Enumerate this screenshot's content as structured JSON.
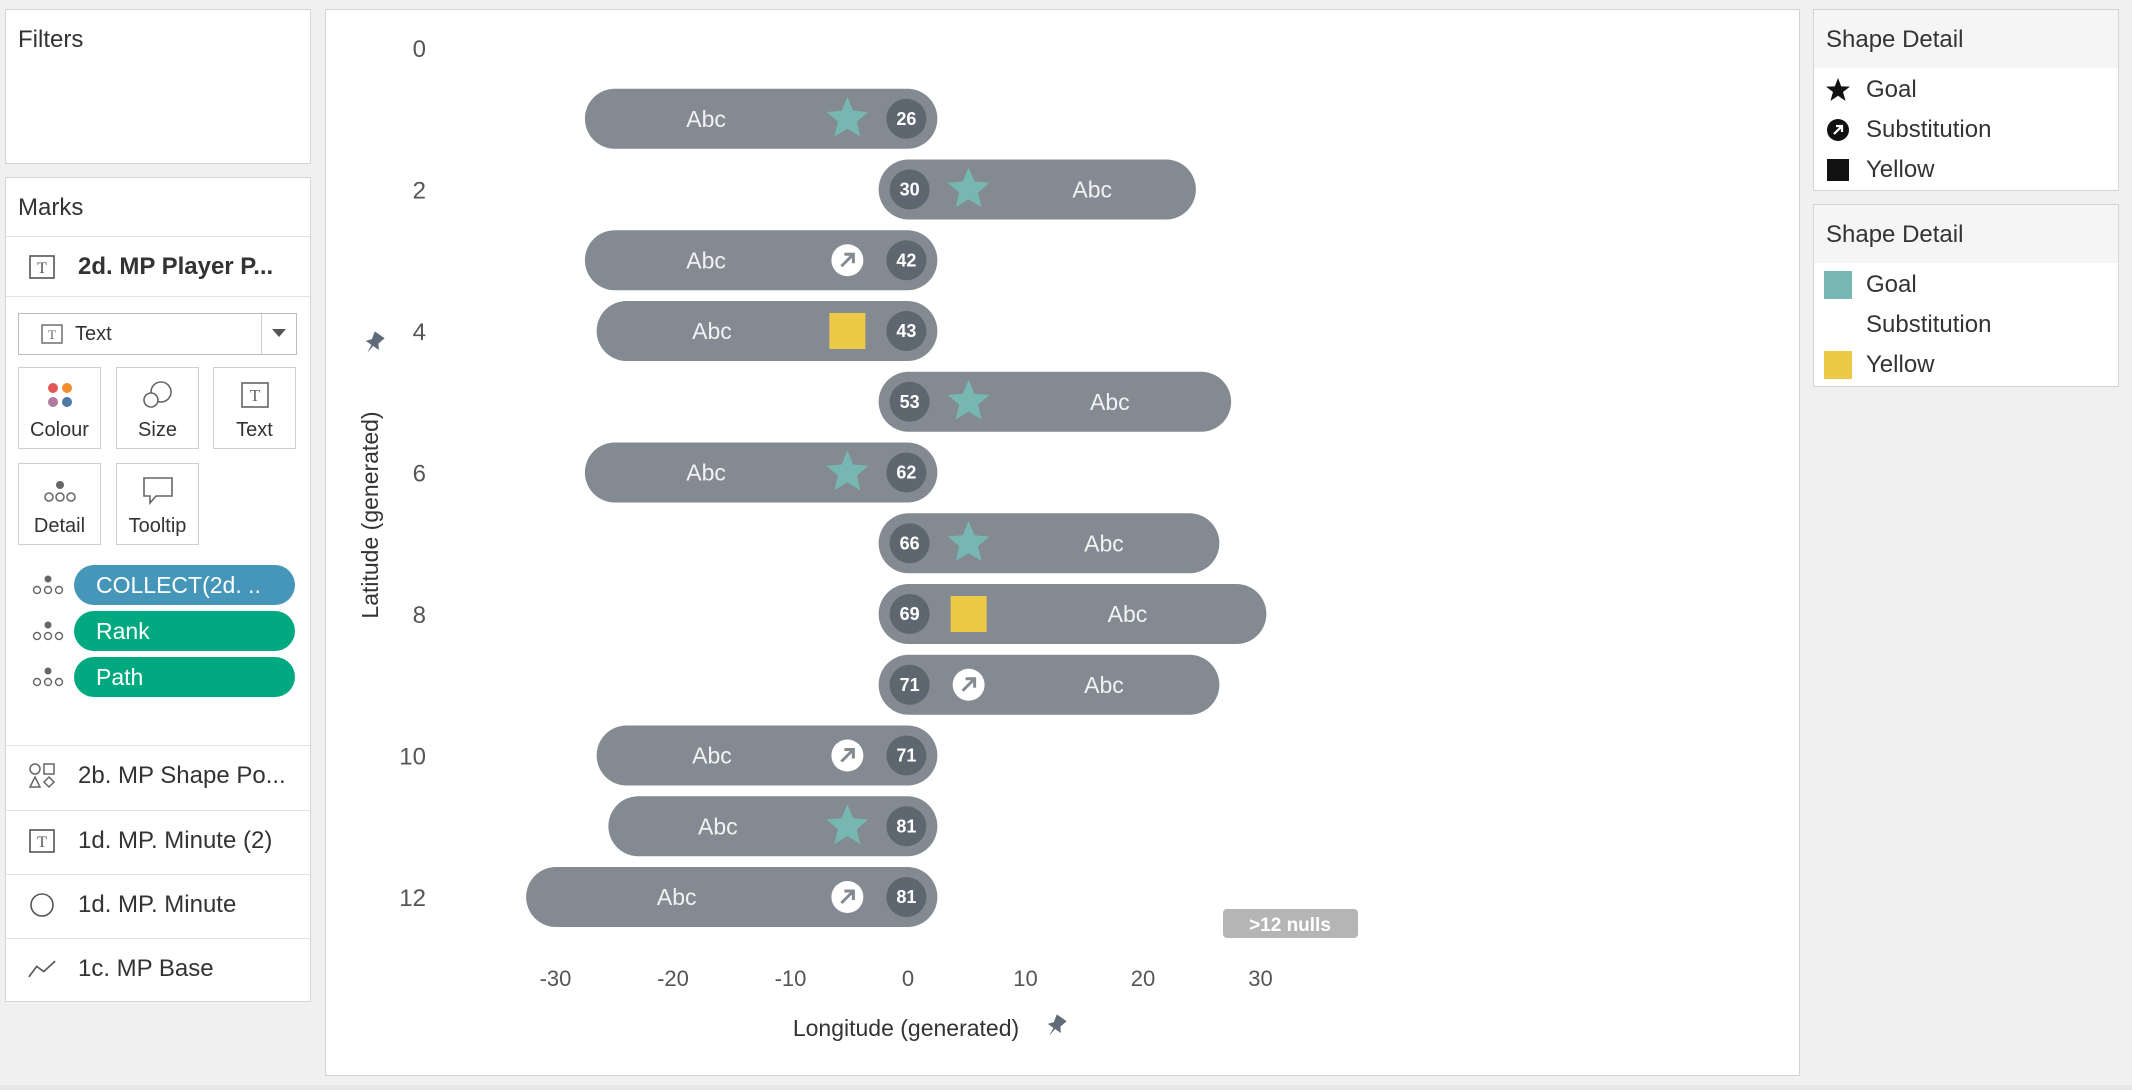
{
  "filters": {
    "title": "Filters"
  },
  "marks": {
    "title": "Marks",
    "active_layer": "2d. MP Player P...",
    "mark_type": "Text",
    "buttons": {
      "colour": "Colour",
      "size": "Size",
      "text": "Text",
      "detail": "Detail",
      "tooltip": "Tooltip"
    },
    "pills": [
      {
        "label": "COLLECT(2d. ..",
        "color": "#4596b8"
      },
      {
        "label": "Rank",
        "color": "#00a97f"
      },
      {
        "label": "Path",
        "color": "#00a97f"
      }
    ],
    "layers": [
      {
        "label": "2b. MP Shape Po...",
        "icon": "shapes-icon"
      },
      {
        "label": "1d. MP. Minute (2)",
        "icon": "text-icon"
      },
      {
        "label": "1d. MP. Minute",
        "icon": "circle-icon"
      },
      {
        "label": "1c. MP Base",
        "icon": "line-icon"
      }
    ]
  },
  "legend_shape": {
    "title": "Shape Detail",
    "items": [
      {
        "label": "Goal",
        "icon": "star-icon"
      },
      {
        "label": "Substitution",
        "icon": "substitution-icon"
      },
      {
        "label": "Yellow",
        "icon": "square-icon"
      }
    ]
  },
  "legend_colour": {
    "title": "Shape Detail",
    "items": [
      {
        "label": "Goal",
        "color": "#76b7b2"
      },
      {
        "label": "Substitution",
        "color": ""
      },
      {
        "label": "Yellow",
        "color": "#edc948"
      }
    ]
  },
  "chart_data": {
    "type": "scatter",
    "xlabel": "Longitude (generated)",
    "ylabel": "Latitude (generated)",
    "x_ticks": [
      -30,
      -20,
      -10,
      0,
      10,
      20,
      30
    ],
    "y_ticks": [
      0,
      2,
      4,
      6,
      8,
      10,
      12
    ],
    "xlim": [
      -31,
      31
    ],
    "ylim": [
      -0.2,
      12.6
    ],
    "nulls_label": ">12 nulls",
    "bar_color": "#838a92",
    "minute_color": "#5e6670",
    "colors": {
      "Goal": "#76b7b2",
      "Yellow": "#edc948"
    },
    "events": [
      {
        "y": 1,
        "minute": "26",
        "event": "Goal",
        "label": "Abc",
        "side": "left",
        "x_end": -27.5
      },
      {
        "y": 2,
        "minute": "30",
        "event": "Goal",
        "label": "Abc",
        "side": "right",
        "x_end": 24.5
      },
      {
        "y": 3,
        "minute": "42",
        "event": "Substitution",
        "label": "Abc",
        "side": "left",
        "x_end": -27.5
      },
      {
        "y": 4,
        "minute": "43",
        "event": "Yellow",
        "label": "Abc",
        "side": "left",
        "x_end": -26.5
      },
      {
        "y": 5,
        "minute": "53",
        "event": "Goal",
        "label": "Abc",
        "side": "right",
        "x_end": 27.5
      },
      {
        "y": 6,
        "minute": "62",
        "event": "Goal",
        "label": "Abc",
        "side": "left",
        "x_end": -27.5
      },
      {
        "y": 7,
        "minute": "66",
        "event": "Goal",
        "label": "Abc",
        "side": "right",
        "x_end": 26.5
      },
      {
        "y": 8,
        "minute": "69",
        "event": "Yellow",
        "label": "Abc",
        "side": "right",
        "x_end": 30.5
      },
      {
        "y": 9,
        "minute": "71",
        "event": "Substitution",
        "label": "Abc",
        "side": "right",
        "x_end": 26.5
      },
      {
        "y": 10,
        "minute": "71",
        "event": "Substitution",
        "label": "Abc",
        "side": "left",
        "x_end": -26.5
      },
      {
        "y": 11,
        "minute": "81",
        "event": "Goal",
        "label": "Abc",
        "side": "left",
        "x_end": -25.5
      },
      {
        "y": 12,
        "minute": "81",
        "event": "Substitution",
        "label": "Abc",
        "side": "left",
        "x_end": -32.5
      }
    ]
  }
}
